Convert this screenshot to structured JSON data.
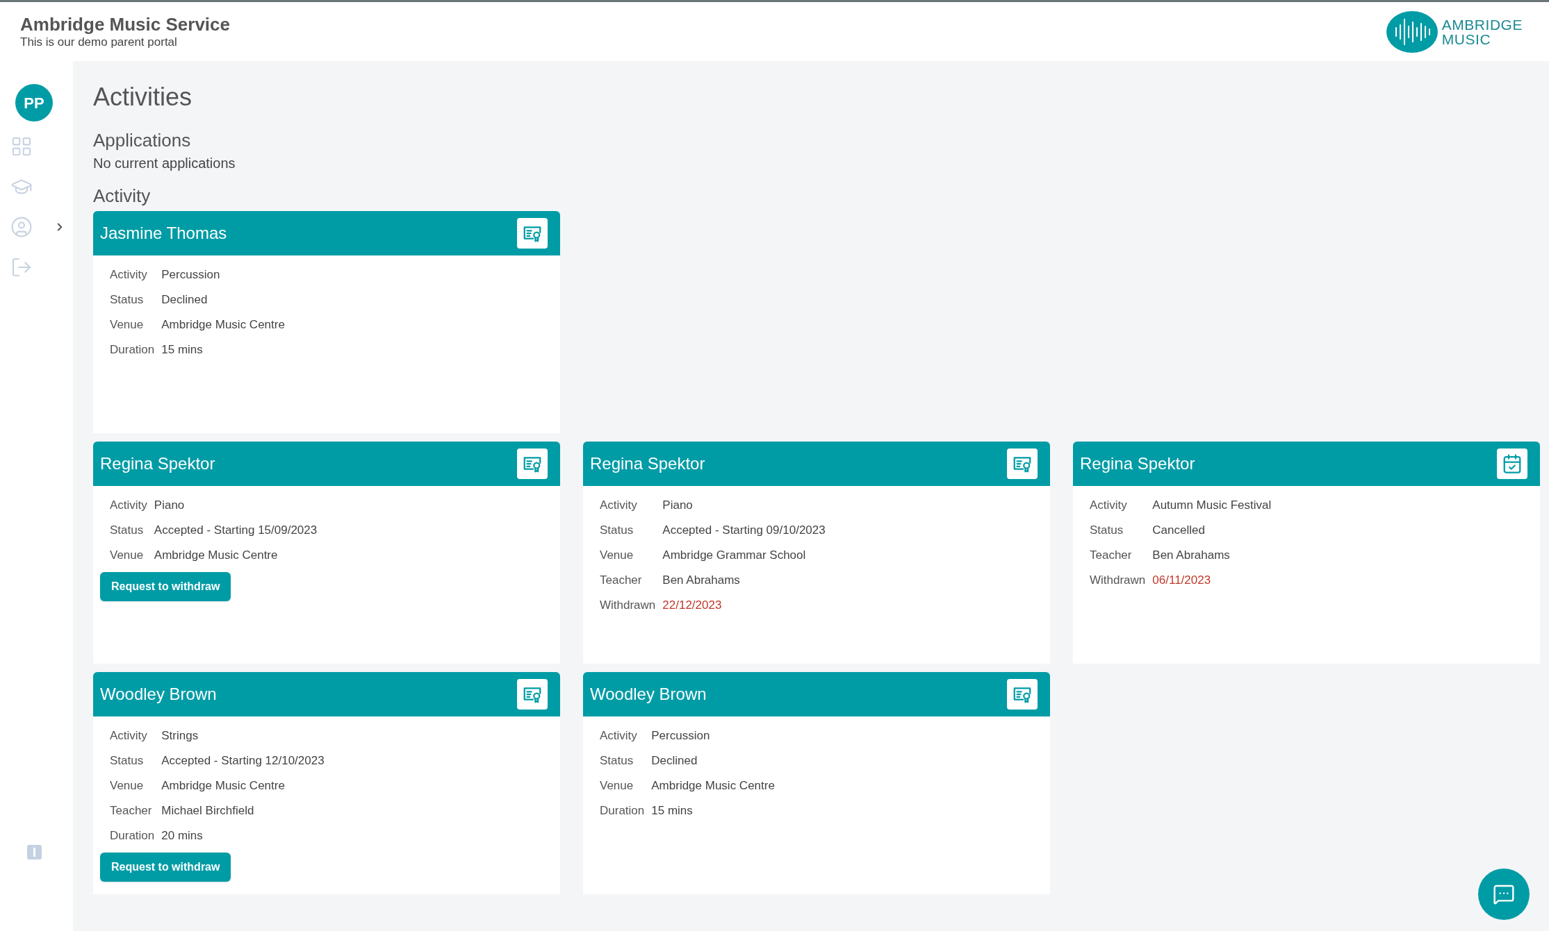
{
  "header": {
    "title": "Ambridge Music Service",
    "subtitle": "This is our demo parent portal",
    "logo_lines": [
      "AMBRIDGE",
      "MUSIC"
    ]
  },
  "sidebar": {
    "avatar": "PP"
  },
  "page_title": "Activities",
  "applications": {
    "heading": "Applications",
    "message": "No current applications"
  },
  "activity": {
    "heading": "Activity",
    "rows": [
      [
        {
          "name": "Jasmine Thomas",
          "kind": "certificate",
          "fields": [
            {
              "label": "Activity",
              "value": "Percussion",
              "alert": false
            },
            {
              "label": "Status",
              "value": "Declined",
              "alert": false
            },
            {
              "label": "Venue",
              "value": "Ambridge Music Centre",
              "alert": false
            },
            {
              "label": "Duration",
              "value": "15 mins",
              "alert": false
            }
          ]
        }
      ],
      [
        {
          "name": "Regina Spektor",
          "kind": "certificate",
          "fields": [
            {
              "label": "Activity",
              "value": "Piano",
              "alert": false
            },
            {
              "label": "Status",
              "value": "Accepted - Starting 15/09/2023",
              "alert": false
            },
            {
              "label": "Venue",
              "value": "Ambridge Music Centre",
              "alert": false
            }
          ],
          "button": "Request to withdraw"
        },
        {
          "name": "Regina Spektor",
          "kind": "certificate",
          "fields": [
            {
              "label": "Activity",
              "value": "Piano",
              "alert": false
            },
            {
              "label": "Status",
              "value": "Accepted - Starting 09/10/2023",
              "alert": false
            },
            {
              "label": "Venue",
              "value": "Ambridge Grammar School",
              "alert": false
            },
            {
              "label": "Teacher",
              "value": "Ben Abrahams",
              "alert": false
            },
            {
              "label": "Withdrawn",
              "value": "22/12/2023",
              "alert": true
            }
          ]
        },
        {
          "name": "Regina Spektor",
          "kind": "calendar",
          "fields": [
            {
              "label": "Activity",
              "value": "Autumn Music Festival",
              "alert": false
            },
            {
              "label": "Status",
              "value": "Cancelled",
              "alert": false
            },
            {
              "label": "Teacher",
              "value": "Ben Abrahams",
              "alert": false
            },
            {
              "label": "Withdrawn",
              "value": "06/11/2023",
              "alert": true
            }
          ]
        }
      ],
      [
        {
          "name": "Woodley Brown",
          "kind": "certificate",
          "fields": [
            {
              "label": "Activity",
              "value": "Strings",
              "alert": false
            },
            {
              "label": "Status",
              "value": "Accepted - Starting 12/10/2023",
              "alert": false
            },
            {
              "label": "Venue",
              "value": "Ambridge Music Centre",
              "alert": false
            },
            {
              "label": "Teacher",
              "value": "Michael Birchfield",
              "alert": false
            },
            {
              "label": "Duration",
              "value": "20 mins",
              "alert": false
            }
          ],
          "button": "Request to withdraw"
        },
        {
          "name": "Woodley Brown",
          "kind": "certificate",
          "fields": [
            {
              "label": "Activity",
              "value": "Percussion",
              "alert": false
            },
            {
              "label": "Status",
              "value": "Declined",
              "alert": false
            },
            {
              "label": "Venue",
              "value": "Ambridge Music Centre",
              "alert": false
            },
            {
              "label": "Duration",
              "value": "15 mins",
              "alert": false
            }
          ]
        }
      ]
    ]
  }
}
